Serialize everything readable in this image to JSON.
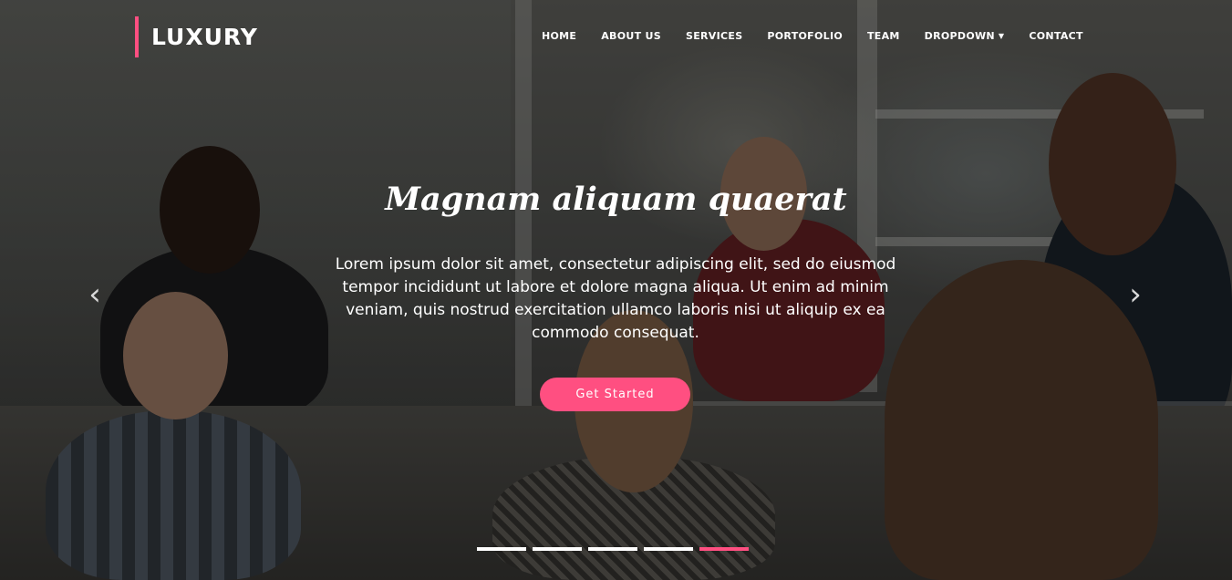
{
  "brand": {
    "name": "LUXURY",
    "accent_color": "#ff4f81"
  },
  "nav": {
    "items": [
      {
        "label": "HOME"
      },
      {
        "label": "ABOUT US"
      },
      {
        "label": "SERVICES"
      },
      {
        "label": "PORTOFOLIO"
      },
      {
        "label": "TEAM"
      },
      {
        "label": "DROPDOWN",
        "has_caret": true
      },
      {
        "label": "CONTACT"
      }
    ],
    "caret_icon": "chevron-down-icon"
  },
  "hero": {
    "title": "Magnam aliquam quaerat",
    "text": "Lorem ipsum dolor sit amet, consectetur adipiscing elit, sed do eiusmod tempor incididunt ut labore et dolore magna aliqua. Ut enim ad minim veniam, quis nostrud exercitation ullamco laboris nisi ut aliquip ex ea commodo consequat.",
    "button_label": "Get Started",
    "button_color": "#ff4f81"
  },
  "carousel": {
    "prev_icon": "chevron-left-icon",
    "next_icon": "chevron-right-icon",
    "slide_count": 5,
    "active_index": 4
  }
}
